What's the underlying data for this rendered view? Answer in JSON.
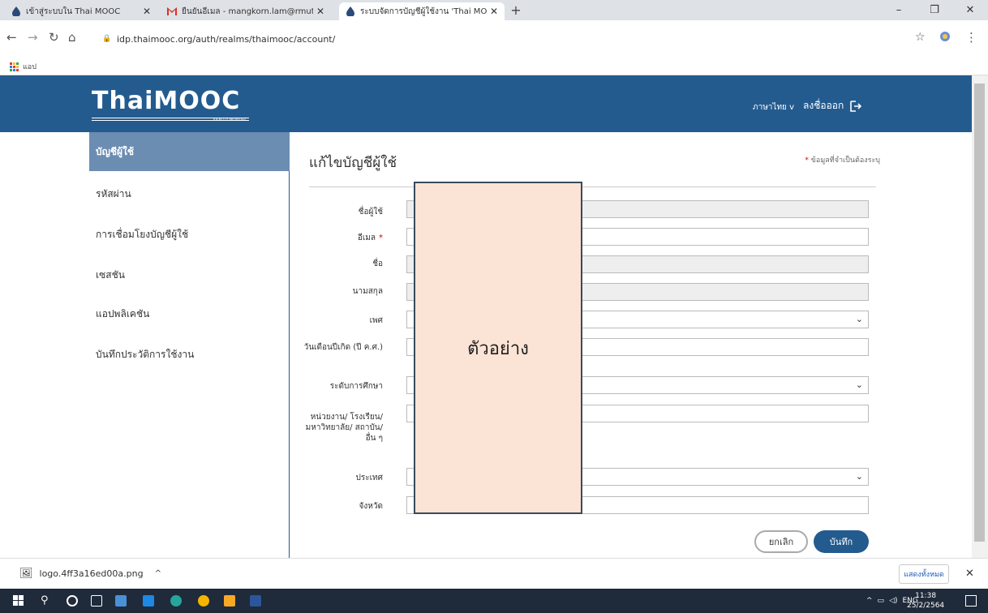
{
  "browser": {
    "tabs": [
      {
        "title": "เข้าสู่ระบบใน Thai MOOC",
        "icon": "thaimooc-icon"
      },
      {
        "title": "ยืนยันอีเมล - mangkorn.lam@rmut",
        "icon": "gmail-icon"
      },
      {
        "title": "ระบบจัดการบัญชีผู้ใช้งาน 'Thai MOO",
        "icon": "thaimooc-icon"
      }
    ],
    "url": "idp.thaimooc.org/auth/realms/thaimooc/account/",
    "bookmarks_label": "แอป"
  },
  "header": {
    "logo_text": "ThaiMOOC",
    "logo_subtext": "IDENTITY PROVIDER",
    "language": "ภาษาไทย v",
    "logout": "ลงชื่อออก"
  },
  "sidebar": {
    "items": [
      {
        "label": "บัญชีผู้ใช้",
        "active": true
      },
      {
        "label": "รหัสผ่าน"
      },
      {
        "label": "การเชื่อมโยงบัญชีผู้ใช้"
      },
      {
        "label": "เซสชัน"
      },
      {
        "label": "แอปพลิเคชัน"
      },
      {
        "label": "บันทึกประวัติการใช้งาน"
      }
    ]
  },
  "form": {
    "title": "แก้ไขบัญชีผู้ใช้",
    "required_note": "ข้อมูลที่จำเป็นต้องระบุ",
    "fields": [
      {
        "label": "ชื่อผู้ใช้",
        "readonly": true
      },
      {
        "label": "อีเมล",
        "required": true
      },
      {
        "label": "ชื่อ",
        "readonly": true
      },
      {
        "label": "นามสกุล",
        "readonly": true
      },
      {
        "label": "เพศ",
        "type": "select"
      },
      {
        "label": "วันเดือนปีเกิด (ปี ค.ศ.)"
      },
      {
        "label": "ระดับการศึกษา",
        "type": "select"
      },
      {
        "label": "หน่วยงาน/ โรงเรียน/ มหาวิทยาลัย/ สถาบัน/อื่น ๆ"
      },
      {
        "label": "ประเทศ",
        "type": "select"
      },
      {
        "label": "จังหวัด"
      }
    ],
    "cancel": "ยกเลิก",
    "save": "บันทึก"
  },
  "overlay_text": "ตัวอย่าง",
  "download": {
    "filename": "logo.4ff3a16ed00a.png",
    "show_all": "แสดงทั้งหมด"
  },
  "taskbar": {
    "lang": "ENG",
    "time": "11:38",
    "date": "25/2/2564"
  },
  "colors": {
    "header": "#245b8f",
    "sidebar_active": "#6b8db2",
    "overlay": "#fbe4d5"
  }
}
